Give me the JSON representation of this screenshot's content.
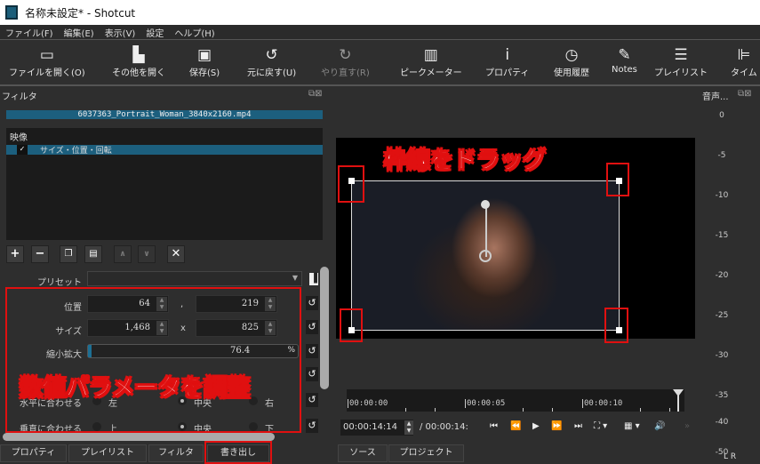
{
  "window": {
    "title": "名称未設定* - Shotcut"
  },
  "menu": [
    "ファイル(F)",
    "編集(E)",
    "表示(V)",
    "設定",
    "ヘルプ(H)"
  ],
  "toolbar": [
    {
      "label": "ファイルを開く(O)",
      "icon": "folder-icon"
    },
    {
      "label": "その他を開く",
      "icon": "open-other-icon"
    },
    {
      "label": "保存(S)",
      "icon": "save-icon"
    },
    {
      "label": "元に戻す(U)",
      "icon": "undo-icon"
    },
    {
      "label": "やり直す(R)",
      "icon": "redo-icon"
    },
    {
      "label": "ピークメーター",
      "icon": "peak-meter-icon"
    },
    {
      "label": "プロパティ",
      "icon": "info-icon"
    },
    {
      "label": "使用履歴",
      "icon": "clock-icon"
    },
    {
      "label": "Notes",
      "icon": "notes-icon"
    },
    {
      "label": "プレイリスト",
      "icon": "list-icon"
    },
    {
      "label": "タイム",
      "icon": "timeline-icon"
    }
  ],
  "filter_panel": {
    "title": "フィルタ",
    "clip": "6037363_Portrait_Woman_3840x2160.mp4",
    "group": "映像",
    "filter": "サイズ・位置・回転",
    "check": "✓",
    "preset_label": "プリセット",
    "position": {
      "label": "位置",
      "x": "64",
      "sep": ",",
      "y": "219"
    },
    "size": {
      "label": "サイズ",
      "w": "1,468",
      "sep": "x",
      "h": "825"
    },
    "zoom": {
      "label": "縮小拡大",
      "value": "76.4",
      "unit": "%",
      "fraction": 0.764
    },
    "halign": {
      "label": "水平に合わせる",
      "options": [
        "左",
        "中央",
        "右"
      ],
      "selected": "中央"
    },
    "valign": {
      "label": "垂直に合わせる",
      "options": [
        "上",
        "中央",
        "下"
      ],
      "selected": "中央"
    }
  },
  "annotations": {
    "drag": "枠線をドラッグ",
    "params": "数値パラメータを調整"
  },
  "meter": {
    "title": "音声...",
    "ticks": [
      "0",
      "-5",
      "-10",
      "-15",
      "-20",
      "-25",
      "-30",
      "-35",
      "-40",
      "-50"
    ],
    "lr": "L R"
  },
  "timeline": {
    "labels": [
      "00:00:00",
      "00:00:05",
      "00:00:10"
    ]
  },
  "player": {
    "current": "00:00:14:14",
    "total": "/ 00:00:14:"
  },
  "left_tabs": [
    "プロパティ",
    "プレイリスト",
    "フィルタ",
    "書き出し"
  ],
  "right_tabs": [
    "ソース",
    "プロジェクト"
  ],
  "colors": {
    "accent": "#1c5f7e",
    "annotation": "#e01010"
  }
}
